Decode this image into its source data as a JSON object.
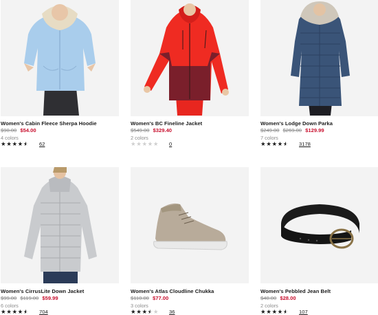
{
  "products": [
    {
      "title": "Women's Cabin Fleece Sherpa Hoodie",
      "prices_old": [
        "$90.00"
      ],
      "price_sale": "$54.00",
      "colors": "4 colors",
      "rating": 4.5,
      "review_count": "62",
      "image": "light-blue-fleece-hoodie"
    },
    {
      "title": "Women's BC Fineline Jacket",
      "prices_old": [
        "$549.00"
      ],
      "price_sale": "$329.40",
      "colors": "2 colors",
      "rating": 0,
      "review_count": "0",
      "image": "red-ski-jacket"
    },
    {
      "title": "Women's Lodge Down Parka",
      "prices_old": [
        "$249.00",
        "$269.00"
      ],
      "price_sale": "$129.99",
      "colors": "7 colors",
      "rating": 4.5,
      "review_count": "3178",
      "image": "navy-down-parka"
    },
    {
      "title": "Women's CirrusLite Down Jacket",
      "prices_old": [
        "$99.00",
        "$119.00"
      ],
      "price_sale": "$59.99",
      "colors": "6 colors",
      "rating": 4.5,
      "review_count": "704",
      "image": "silver-down-jacket"
    },
    {
      "title": "Women's Atlas Cloudline Chukka",
      "prices_old": [
        "$110.00"
      ],
      "price_sale": "$77.00",
      "colors": "3 colors",
      "rating": 3.5,
      "review_count": "36",
      "image": "taupe-chukka-shoe"
    },
    {
      "title": "Women's Pebbled Jean Belt",
      "prices_old": [
        "$40.00"
      ],
      "price_sale": "$28.00",
      "colors": "2 colors",
      "rating": 4.5,
      "review_count": "107",
      "image": "black-leather-belt"
    }
  ],
  "colors": {
    "sale": "#c8102e",
    "muted": "#8a8a8a",
    "star": "#1a1a1a",
    "star_empty": "#cfcfcf",
    "image_bg": "#f3f3f3"
  }
}
